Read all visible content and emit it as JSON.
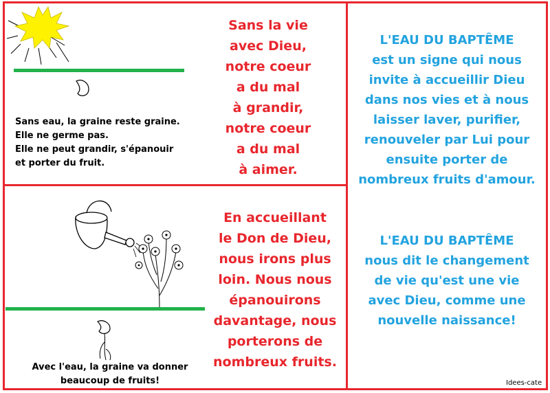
{
  "top_left": {
    "caption_lines": [
      "Sans eau, la graine reste graine.",
      "Elle ne germe pas.",
      "Elle ne peut grandir, s'épanouir",
      "et porter du fruit."
    ],
    "poem_lines": [
      "Sans la vie",
      "avec Dieu,",
      "notre coeur",
      "a du mal",
      "à grandir,",
      "notre coeur",
      "a du mal",
      "à aimer."
    ]
  },
  "bottom_left": {
    "caption_lines": [
      "Avec l'eau, la graine va donner",
      "beaucoup de fruits!"
    ],
    "poem_lines": [
      "En accueillant",
      "le Don de Dieu,",
      "nous irons plus",
      "loin. Nous nous",
      "épanouirons",
      "davantage, nous",
      "porterons de",
      "nombreux fruits."
    ]
  },
  "right": {
    "block1_lines": [
      "L'EAU DU BAPTÊME",
      "est un signe qui nous",
      "invite à accueillir Dieu",
      "dans nos vies et à nous",
      "laisser laver, purifier,",
      "renouveler  par Lui pour",
      "ensuite porter de",
      "nombreux fruits d'amour."
    ],
    "block2_lines": [
      "L'EAU DU BAPTÊME",
      "nous dit le changement",
      "de vie qu'est une vie",
      "avec Dieu, comme une",
      "nouvelle naissance!"
    ]
  },
  "credit": "Idees-cate",
  "colors": {
    "border": "#e8262d",
    "poem_red": "#e8262d",
    "text_blue": "#22a3df",
    "ground_green": "#21b24b",
    "sun_yellow": "#fff200"
  }
}
